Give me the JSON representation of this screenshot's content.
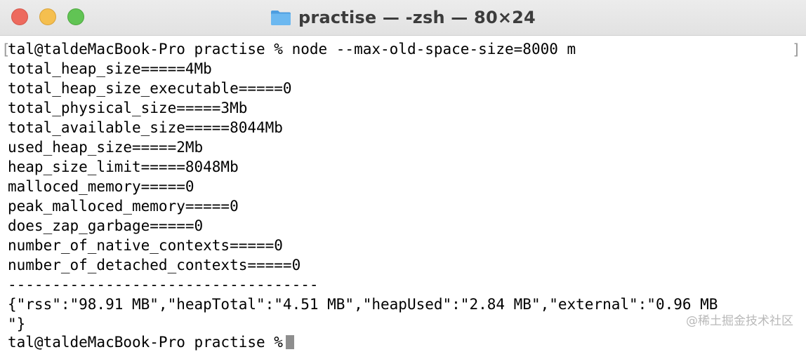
{
  "window": {
    "title": "practise — -zsh — 80×24",
    "folder_icon": "folder-icon",
    "buttons": {
      "close": "close-button",
      "minimize": "minimize-button",
      "maximize": "maximize-button"
    }
  },
  "terminal": {
    "lines": [
      "tal@taldeMacBook-Pro practise % node --max-old-space-size=8000 m",
      "total_heap_size=====4Mb",
      "total_heap_size_executable=====0",
      "total_physical_size=====3Mb",
      "total_available_size=====8044Mb",
      "used_heap_size=====2Mb",
      "heap_size_limit=====8048Mb",
      "malloced_memory=====0",
      "peak_malloced_memory=====0",
      "does_zap_garbage=====0",
      "number_of_native_contexts=====0",
      "number_of_detached_contexts=====0",
      "-----------------------------------",
      "{\"rss\":\"98.91 MB\",\"heapTotal\":\"4.51 MB\",\"heapUsed\":\"2.84 MB\",\"external\":\"0.96 MB",
      "\"}",
      "tal@taldeMacBook-Pro practise %"
    ],
    "left_bracket": "[",
    "right_bracket": "]"
  },
  "watermark": "@稀土掘金技术社区",
  "colors": {
    "close": "#ed6a5e",
    "minimize": "#f5bf4f",
    "maximize": "#61c454",
    "folder": "#5aa8e6"
  }
}
